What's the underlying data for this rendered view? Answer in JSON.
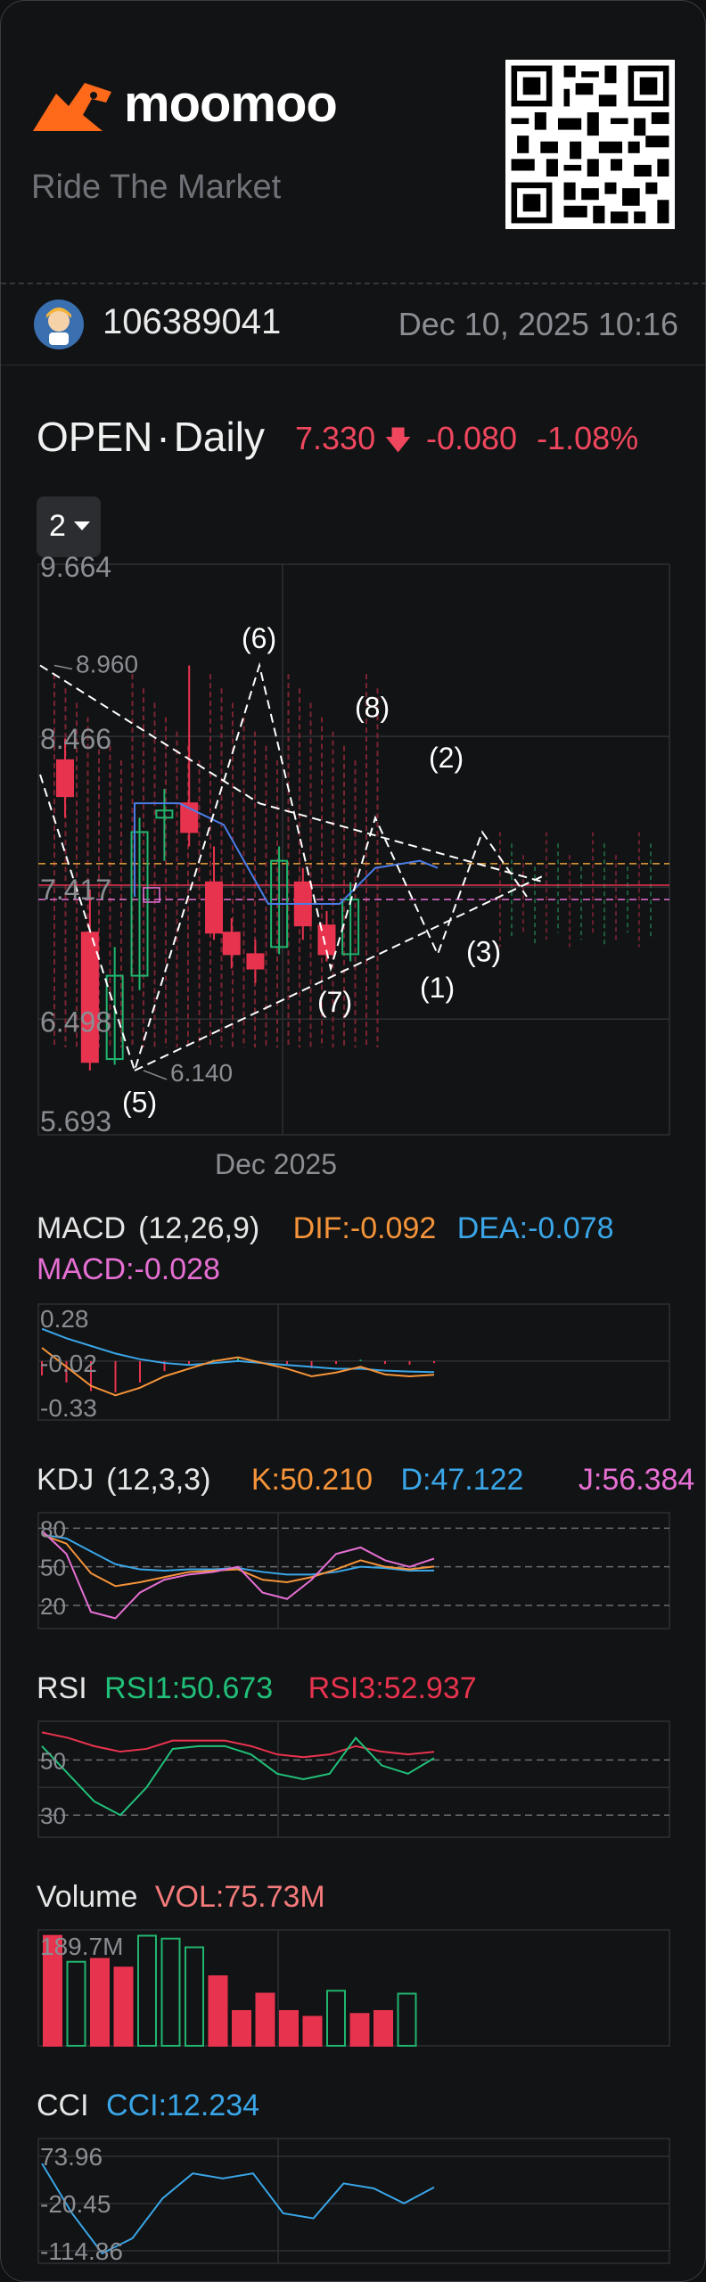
{
  "colors": {
    "up": "#21b56f",
    "down": "#e8334f",
    "dif": "#f5943a",
    "dea": "#3aa6e8",
    "macd": "#e66fd4",
    "k": "#f5943a",
    "d": "#3aa6e8",
    "j": "#e66fd4",
    "rsi1": "#21c07a",
    "rsi3": "#e8334f",
    "cci": "#3aa6e8"
  },
  "header": {
    "brand": "moomoo",
    "tagline": "Ride The Market"
  },
  "user": {
    "id": "106389041",
    "timestamp": "Dec 10, 2025 10:16"
  },
  "quote": {
    "symbol": "OPEN",
    "sep": "·",
    "period": "Daily",
    "price": "7.330",
    "change": "-0.080",
    "change_pct": "-1.08%"
  },
  "chart_controls": {
    "selector": "2"
  },
  "chart_data": [
    {
      "type": "candlestick",
      "y_labels": [
        "9.664",
        "8.466",
        "7.417",
        "6.498",
        "5.693"
      ],
      "x_label": "Dec 2025",
      "price_annotations": [
        "8.960",
        "6.140"
      ],
      "wave_labels": [
        "(1)",
        "(2)",
        "(3)",
        "(5)",
        "(6)",
        "(7)",
        "(8)"
      ],
      "candles": [
        {
          "o": 8.3,
          "c": 8.05,
          "h": 8.45,
          "l": 7.9
        },
        {
          "o": 7.1,
          "c": 6.2,
          "h": 7.4,
          "l": 6.14
        },
        {
          "o": 6.22,
          "c": 6.8,
          "h": 7.0,
          "l": 6.18
        },
        {
          "o": 6.8,
          "c": 7.8,
          "h": 7.9,
          "l": 6.7
        },
        {
          "o": 7.9,
          "c": 7.95,
          "h": 8.1,
          "l": 7.6
        },
        {
          "o": 8.0,
          "c": 7.8,
          "h": 8.96,
          "l": 7.7
        },
        {
          "o": 7.45,
          "c": 7.1,
          "h": 7.7,
          "l": 7.05
        },
        {
          "o": 7.1,
          "c": 6.95,
          "h": 7.2,
          "l": 6.85
        },
        {
          "o": 6.95,
          "c": 6.85,
          "h": 7.05,
          "l": 6.75
        },
        {
          "o": 7.0,
          "c": 7.6,
          "h": 7.7,
          "l": 6.95
        },
        {
          "o": 7.45,
          "c": 7.15,
          "h": 7.55,
          "l": 7.05
        },
        {
          "o": 7.15,
          "c": 6.95,
          "h": 7.25,
          "l": 6.9
        },
        {
          "o": 6.95,
          "c": 7.33,
          "h": 7.45,
          "l": 6.9
        }
      ]
    },
    {
      "type": "line",
      "name": "MACD",
      "params": "(12,26,9)",
      "dif": "DIF:-0.092",
      "dea": "DEA:-0.078",
      "macd": "MACD:-0.028",
      "y_labels": [
        "0.28",
        "-0.02",
        "-0.33"
      ],
      "dif_values": [
        0.05,
        -0.05,
        -0.15,
        -0.2,
        -0.16,
        -0.1,
        -0.06,
        -0.02,
        0.0,
        -0.03,
        -0.06,
        -0.1,
        -0.08,
        -0.05,
        -0.09,
        -0.1,
        -0.092
      ],
      "dea_values": [
        0.15,
        0.1,
        0.06,
        0.02,
        -0.01,
        -0.03,
        -0.04,
        -0.03,
        -0.02,
        -0.03,
        -0.04,
        -0.05,
        -0.06,
        -0.06,
        -0.07,
        -0.075,
        -0.078
      ]
    },
    {
      "type": "line",
      "name": "KDJ",
      "params": "(12,3,3)",
      "k": "K:50.210",
      "d": "D:47.122",
      "j": "J:56.384",
      "y_labels": [
        "80",
        "50",
        "20"
      ],
      "k_values": [
        75,
        68,
        45,
        35,
        38,
        42,
        46,
        47,
        48,
        40,
        38,
        42,
        48,
        55,
        50,
        48,
        50.21
      ],
      "d_values": [
        75,
        72,
        62,
        52,
        48,
        47,
        48,
        48,
        49,
        46,
        44,
        44,
        46,
        50,
        49,
        47,
        47.12
      ],
      "j_values": [
        78,
        60,
        15,
        10,
        30,
        40,
        44,
        46,
        50,
        30,
        25,
        40,
        60,
        65,
        55,
        50,
        56.38
      ]
    },
    {
      "type": "line",
      "name": "RSI",
      "r1": "RSI1:50.673",
      "r3": "RSI3:52.937",
      "y_labels": [
        "50",
        "30"
      ],
      "rsi1_values": [
        55,
        45,
        35,
        30,
        40,
        54,
        55,
        55,
        52,
        45,
        43,
        45,
        58,
        48,
        45,
        50.67
      ],
      "rsi3_values": [
        60,
        58,
        55,
        53,
        54,
        57,
        57,
        57,
        55,
        52,
        51,
        52,
        55,
        53,
        52,
        52.94
      ]
    },
    {
      "type": "bar",
      "name": "Volume",
      "vol": "VOL:75.73M",
      "y_labels": [
        "189.7M"
      ],
      "values": [
        189.7,
        145,
        150,
        135,
        190,
        185,
        170,
        120,
        60,
        90,
        60,
        50,
        95,
        55,
        60,
        90
      ],
      "directions": [
        "down",
        "up",
        "down",
        "down",
        "up",
        "up",
        "up",
        "down",
        "down",
        "down",
        "down",
        "down",
        "up",
        "down",
        "down",
        "up"
      ]
    },
    {
      "type": "line",
      "name": "CCI",
      "cci": "CCI:12.234",
      "y_labels": [
        "73.96",
        "-20.45",
        "-114.86"
      ],
      "values": [
        60,
        -40,
        -120,
        -90,
        -10,
        40,
        30,
        40,
        -40,
        -50,
        20,
        10,
        -20,
        12.23
      ]
    }
  ]
}
